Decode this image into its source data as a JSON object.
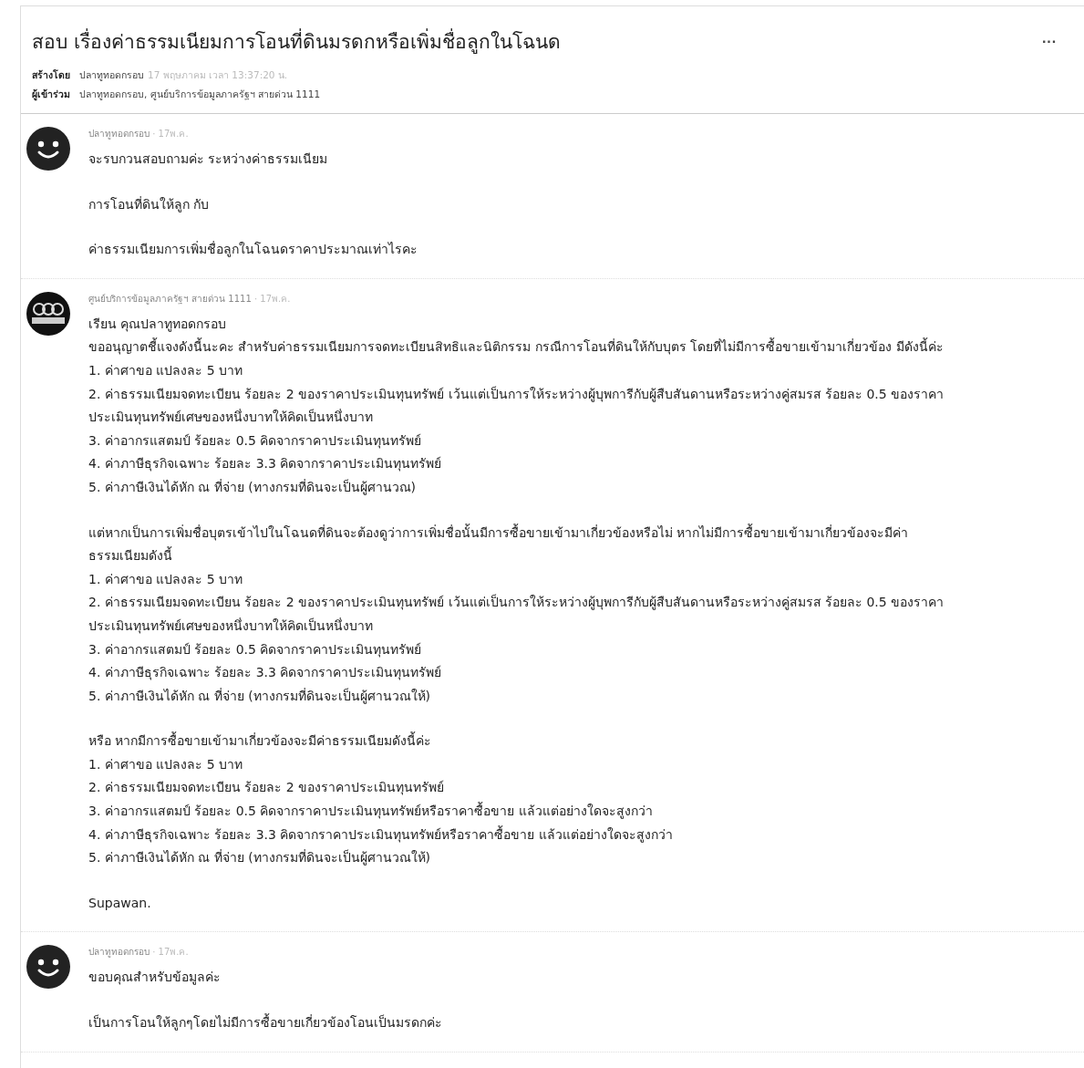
{
  "post": {
    "title": "สอบ เรื่องค่าธรรมเนียมการโอนที่ดินมรดกหรือเพิ่มชื่อลูกในโฉนด",
    "menu": "···",
    "created_label": "สร้างโดย",
    "created_by": "ปลาทูทอดกรอบ",
    "created_at": "17 พฤษภาคม เวลา 13:37:20 น.",
    "participants_label": "ผู้เข้าร่วม",
    "participants": "ปลาทูทอดกรอบ, ศูนย์บริการข้อมูลภาครัฐฯ สายด่วน 1111"
  },
  "messages": [
    {
      "author": "ปลาทูทอดกรอบ",
      "date": "· 17พ.ค.",
      "kind": "smiley",
      "paragraphs": [
        [
          "จะรบกวนสอบถามค่ะ ระหว่างค่าธรรมเนียม"
        ],
        [
          "การโอนที่ดินให้ลูก กับ"
        ],
        [
          "ค่าธรรมเนียมการเพิ่มชื่อลูกในโฉนดราคาประมาณเท่าไรคะ"
        ]
      ]
    },
    {
      "author": "ศูนย์บริการข้อมูลภาครัฐฯ สายด่วน 1111",
      "date": "· 17พ.ค.",
      "kind": "logo",
      "paragraphs": [
        [
          "เรียน คุณปลาทูทอดกรอบ",
          "ขออนุญาตชี้แจงดังนี้นะคะ สำหรับค่าธรรมเนียมการจดทะเบียนสิทธิและนิติกรรม กรณีการโอนที่ดินให้กับบุตร โดยที่ไม่มีการซื้อขายเข้ามาเกี่ยวข้อง มีดังนี้ค่ะ",
          "1. ค่าศาขอ แปลงละ 5  บาท",
          "2. ค่าธรรมเนียมจดทะเบียน ร้อยละ 2 ของราคาประเมินทุนทรัพย์ เว้นแต่เป็นการให้ระหว่างผู้บุพการีกับผู้สืบสันดานหรือระหว่างคู่สมรส ร้อยละ 0.5 ของราคา",
          "ประเมินทุนทรัพย์เศษของหนึ่งบาทให้คิดเป็นหนึ่งบาท",
          "3. ค่าอากรแสตมป์ ร้อยละ 0.5  คิดจากราคาประเมินทุนทรัพย์",
          "4. ค่าภาษีธุรกิจเฉพาะ ร้อยละ 3.3 คิดจากราคาประเมินทุนทรัพย์",
          "5. ค่าภาษีเงินได้หัก ณ ที่จ่าย (ทางกรมที่ดินจะเป็นผู้ศานวณ)"
        ],
        [
          "แต่หากเป็นการเพิ่มชื่อบุตรเข้าไปในโฉนดที่ดินจะต้องดูว่าการเพิ่มชื่อนั้นมีการซื้อขายเข้ามาเกี่ยวข้องหรือไม่ หากไม่มีการซื้อขายเข้ามาเกี่ยวข้องจะมีค่า",
          "ธรรมเนียมดังนี้",
          "1. ค่าศาขอ แปลงละ 5  บาท",
          "2. ค่าธรรมเนียมจดทะเบียน ร้อยละ 2 ของราคาประเมินทุนทรัพย์ เว้นแต่เป็นการให้ระหว่างผู้บุพการีกับผู้สืบสันดานหรือระหว่างคู่สมรส ร้อยละ 0.5 ของราคา",
          "ประเมินทุนทรัพย์เศษของหนึ่งบาทให้คิดเป็นหนึ่งบาท",
          "3. ค่าอากรแสตมป์ ร้อยละ 0.5  คิดจากราคาประเมินทุนทรัพย์",
          "4. ค่าภาษีธุรกิจเฉพาะ ร้อยละ 3.3 คิดจากราคาประเมินทุนทรัพย์",
          "5. ค่าภาษีเงินได้หัก ณ ที่จ่าย (ทางกรมที่ดินจะเป็นผู้ศานวณให้)"
        ],
        [
          "หรือ หากมีการซื้อขายเข้ามาเกี่ยวข้องจะมีค่าธรรมเนียมดังนี้ค่ะ",
          "1. ค่าศาขอ แปลงละ 5 บาท",
          "2. ค่าธรรมเนียมจดทะเบียน ร้อยละ 2  ของราคาประเมินทุนทรัพย์",
          "3. ค่าอากรแสตมป์ ร้อยละ 0.5  คิดจากราคาประเมินทุนทรัพย์หรือราคาซื้อขาย แล้วแต่อย่างใดจะสูงกว่า",
          "4. ค่าภาษีธุรกิจเฉพาะ ร้อยละ 3.3 คิดจากราคาประเมินทุนทรัพย์หรือราคาซื้อขาย แล้วแต่อย่างใดจะสูงกว่า",
          "5. ค่าภาษีเงินได้หัก ณ ที่จ่าย (ทางกรมที่ดินจะเป็นผู้ศานวณให้)"
        ],
        [
          "Supawan."
        ]
      ]
    },
    {
      "author": "ปลาทูทอดกรอบ",
      "date": "· 17พ.ค.",
      "kind": "smiley",
      "paragraphs": [
        [
          "ขอบคุณสำหรับข้อมูลค่ะ"
        ],
        [
          "เป็นการโอนให้ลูกๆโดยไม่มีการซื้อขายเกี่ยวข้องโอนเป็นมรดกค่ะ"
        ]
      ]
    }
  ]
}
